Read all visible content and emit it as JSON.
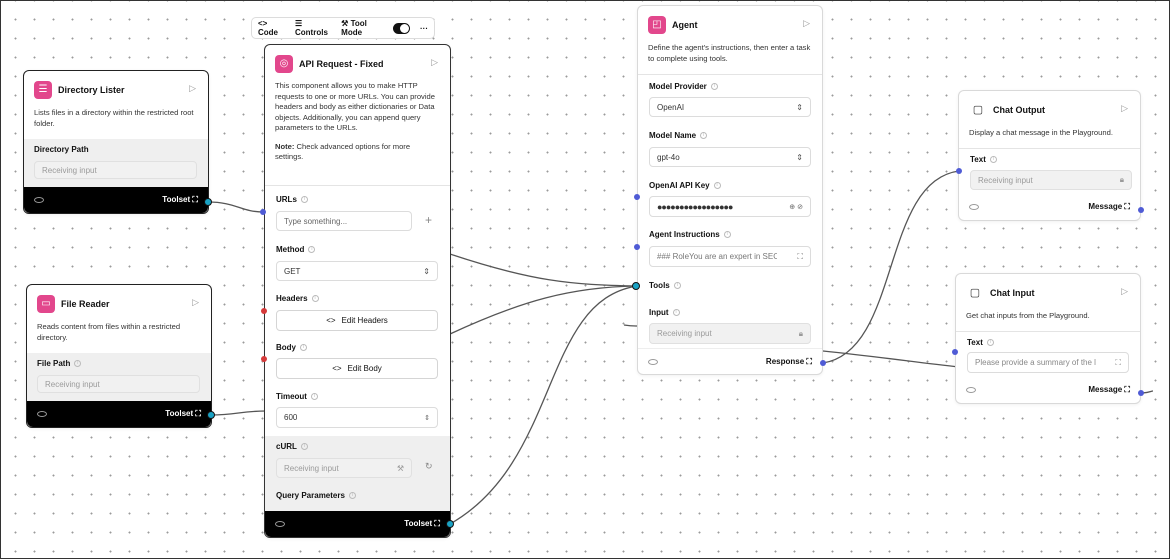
{
  "toolbar": {
    "code": "Code",
    "controls": "Controls",
    "tool_mode": "Tool Mode",
    "more": "···"
  },
  "directory_lister": {
    "title": "Directory Lister",
    "desc": "Lists files in a directory within the restricted root folder.",
    "field": "Directory Path",
    "placeholder": "Receiving input",
    "footer": "Toolset"
  },
  "file_reader": {
    "title": "File Reader",
    "desc": "Reads content from files within a restricted directory.",
    "field": "File Path",
    "placeholder": "Receiving input",
    "footer": "Toolset"
  },
  "api": {
    "title": "API Request - Fixed",
    "desc": "This component allows you to make HTTP requests to one or more URLs. You can provide headers and body as either dictionaries or Data objects. Additionally, you can append query parameters to the URLs.",
    "note_label": "Note:",
    "note": " Check advanced options for more settings.",
    "urls_label": "URLs",
    "urls_placeholder": "Type something...",
    "method_label": "Method",
    "method_value": "GET",
    "headers_label": "Headers",
    "headers_btn": "Edit Headers",
    "body_label": "Body",
    "body_btn": "Edit Body",
    "timeout_label": "Timeout",
    "timeout_value": "600",
    "curl_label": "cURL",
    "curl_placeholder": "Receiving input",
    "query_label": "Query Parameters",
    "footer": "Toolset"
  },
  "agent": {
    "title": "Agent",
    "desc": "Define the agent's instructions, then enter a task to complete using tools.",
    "provider_label": "Model Provider",
    "provider_value": "OpenAI",
    "model_label": "Model Name",
    "model_value": "gpt-4o",
    "key_label": "OpenAI API Key",
    "key_value": "●●●●●●●●●●●●●●●●●",
    "instr_label": "Agent Instructions",
    "instr_value": "### RoleYou are an expert in SEO c",
    "tools_label": "Tools",
    "input_label": "Input",
    "input_placeholder": "Receiving input",
    "footer": "Response"
  },
  "chat_output": {
    "title": "Chat Output",
    "desc": "Display a chat message in the Playground.",
    "field": "Text",
    "placeholder": "Receiving input",
    "footer": "Message"
  },
  "chat_input": {
    "title": "Chat Input",
    "desc": "Get chat inputs from the Playground.",
    "field": "Text",
    "placeholder": "Please provide a summary of the l",
    "footer": "Message"
  },
  "colors": {
    "accent": "#e2478c",
    "handle_blue": "#4f5bd5",
    "handle_red": "#d63a3a",
    "handle_teal": "#1aa2c4"
  }
}
